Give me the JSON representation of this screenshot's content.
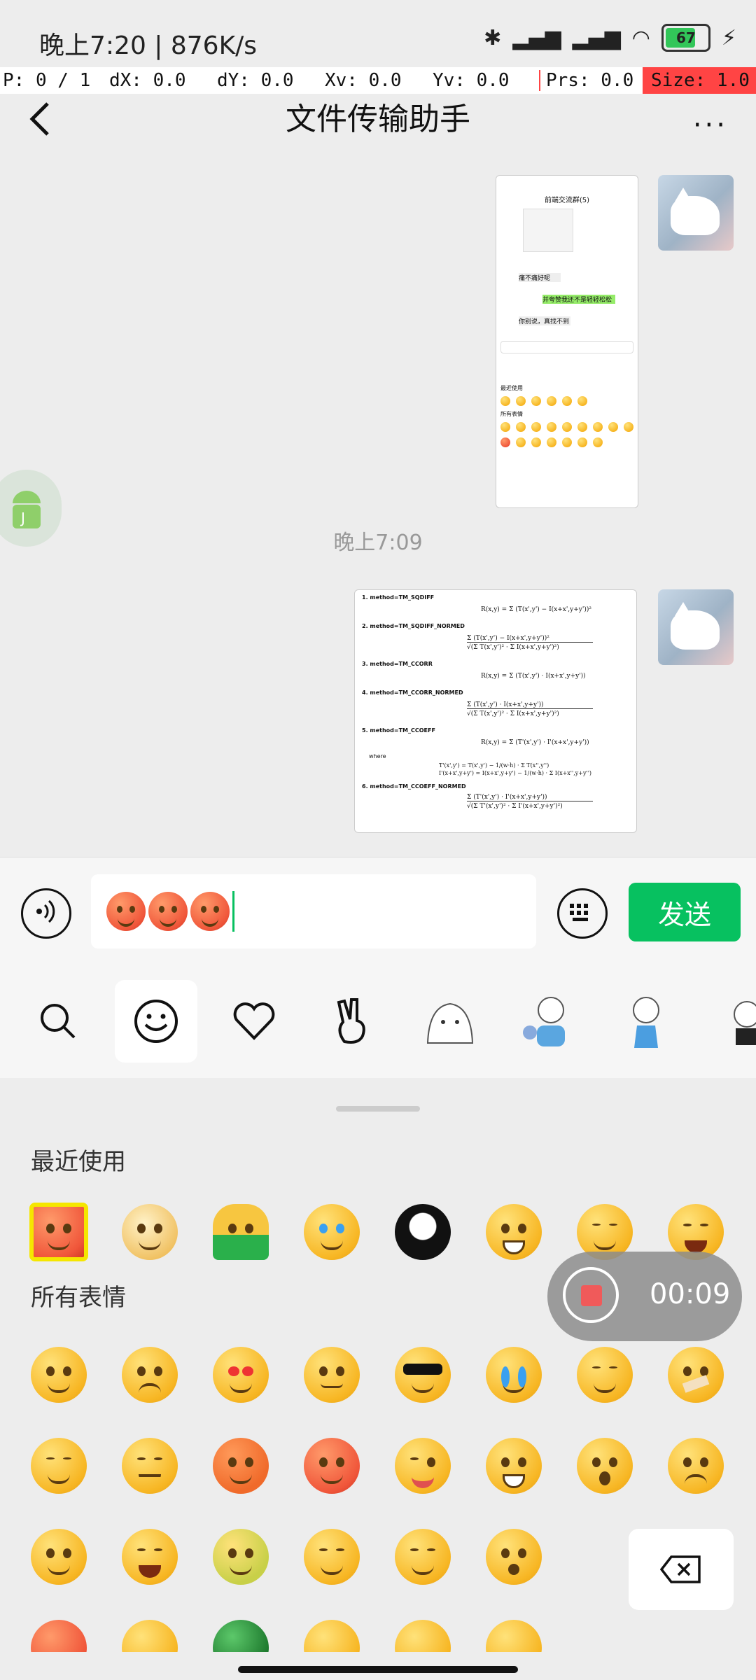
{
  "status_bar": {
    "time_speed": "晚上7:20 | 876K/s",
    "battery": "67"
  },
  "debug_bar": {
    "pointer": "P: 0 / 1",
    "dx": "dX: 0.0",
    "dy": "dY: 0.0",
    "xv": "Xv: 0.0",
    "yv": "Yv: 0.0",
    "prs": "Prs: 0.0",
    "size": "Size: 1.0"
  },
  "header": {
    "title": "文件传输助手",
    "more_label": "···"
  },
  "chat": {
    "timestamp": "晚上7:09",
    "screenshot1": {
      "title": "前端交流群(5)",
      "msgs": [
        "痛不痛好呢",
        "并夸赞我还不是轻轻松松",
        "你别说，真找不到"
      ],
      "sections": [
        "最近使用",
        "所有表情"
      ]
    },
    "screenshot2": {
      "lines": [
        "1. method=TM_SQDIFF",
        "2. method=TM_SQDIFF_NORMED",
        "3. method=TM_CCORR",
        "4. method=TM_CCORR_NORMED",
        "5. method=TM_CCOEFF",
        "where",
        "6. method=TM_CCOEFF_NORMED"
      ]
    }
  },
  "input": {
    "value_text": "",
    "send_label": "发送"
  },
  "emoji_panel": {
    "recent_title": "最近使用",
    "all_title": "所有表情",
    "recorder_time": "00:09"
  }
}
